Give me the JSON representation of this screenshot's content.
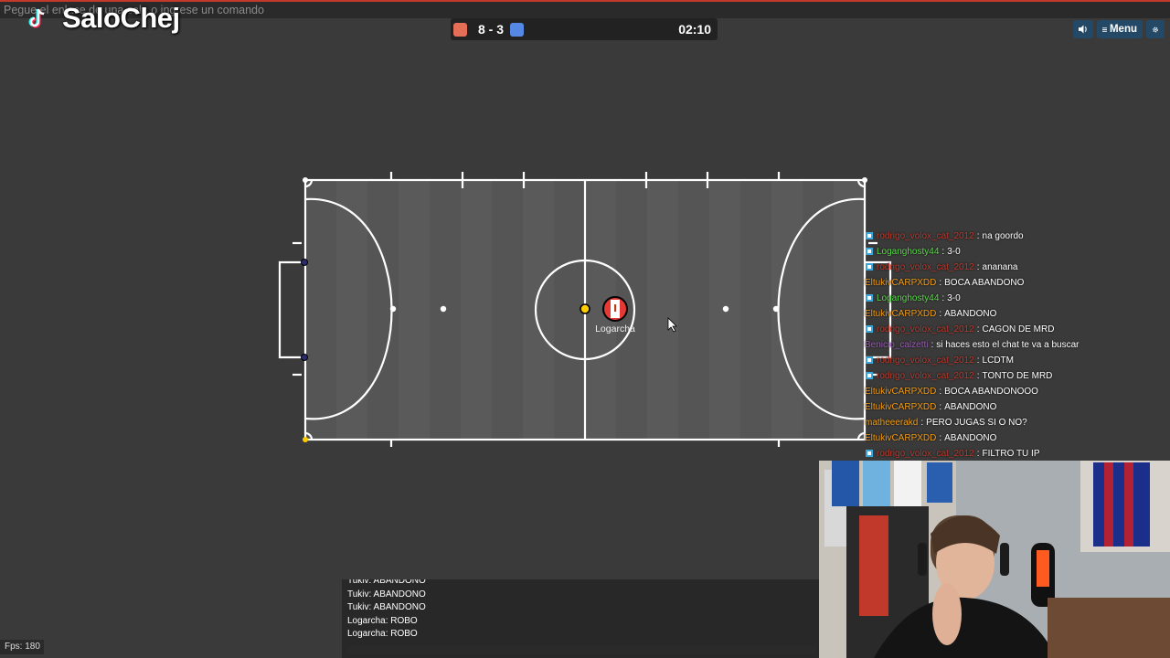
{
  "command_bar": {
    "placeholder": "Pegue el enlace de una sala o ingrese un comando"
  },
  "watermark": {
    "text": "SaloChej",
    "logo_icon": "tiktok-icon"
  },
  "scoreboard": {
    "red_score": 8,
    "separator": "-",
    "blue_score": 3,
    "score_text": "8 - 3",
    "time": "02:10",
    "red_color": "#e56e56",
    "blue_color": "#5689e5"
  },
  "top_buttons": {
    "sound_icon": "speaker-icon",
    "menu_label": "Menu",
    "menu_icon": "hamburger-icon",
    "settings_icon": "gear-icon"
  },
  "field": {
    "player_name": "Logarcha",
    "ball_color": "#ffcc00",
    "player_avatar_icon": "peru-flag-icon"
  },
  "chat": [
    {
      "name": "rodrigo_volox_cat_2012",
      "color": "#c0392b",
      "icon": true,
      "msg": "na goordo"
    },
    {
      "name": "Loganghosty44",
      "color": "#5bd84a",
      "icon": true,
      "msg": "3-0"
    },
    {
      "name": "rodrigo_volox_cat_2012",
      "color": "#c0392b",
      "icon": true,
      "msg": "ananana"
    },
    {
      "name": "EltukivCARPXDD",
      "color": "#f39c12",
      "icon": false,
      "msg": "BOCA ABANDONO"
    },
    {
      "name": "Loganghosty44",
      "color": "#5bd84a",
      "icon": true,
      "msg": "3-0"
    },
    {
      "name": "EltukivCARPXDD",
      "color": "#f39c12",
      "icon": false,
      "msg": "ABANDONO"
    },
    {
      "name": "rodrigo_volox_cat_2012",
      "color": "#c0392b",
      "icon": true,
      "msg": "CAGON DE MRD"
    },
    {
      "name": "Benicio_calzetti",
      "color": "#9b59b6",
      "icon": false,
      "msg": "si haces esto el chat te va a buscar"
    },
    {
      "name": "rodrigo_volox_cat_2012",
      "color": "#c0392b",
      "icon": true,
      "msg": "LCDTM"
    },
    {
      "name": "rodrigo_volox_cat_2012",
      "color": "#c0392b",
      "icon": true,
      "msg": "TONTO DE MRD"
    },
    {
      "name": "EltukivCARPXDD",
      "color": "#f39c12",
      "icon": false,
      "msg": "BOCA ABANDONOOO"
    },
    {
      "name": "EltukivCARPXDD",
      "color": "#f39c12",
      "icon": false,
      "msg": "ABANDONO"
    },
    {
      "name": "matheeerakd",
      "color": "#f39c12",
      "icon": false,
      "msg": "PERO JUGAS SI O NO?"
    },
    {
      "name": "EltukivCARPXDD",
      "color": "#f39c12",
      "icon": false,
      "msg": "ABANDONO"
    },
    {
      "name": "rodrigo_volox_cat_2012",
      "color": "#c0392b",
      "icon": true,
      "msg": "FILTRO TU IP"
    }
  ],
  "game_chat": {
    "lines": [
      "Tukiv: ABANDONO",
      "Tukiv: ABANDONO",
      "Tukiv: ABANDONO",
      "Logarcha: ROBO",
      "Logarcha: ROBO"
    ]
  },
  "fps": "Fps: 180"
}
